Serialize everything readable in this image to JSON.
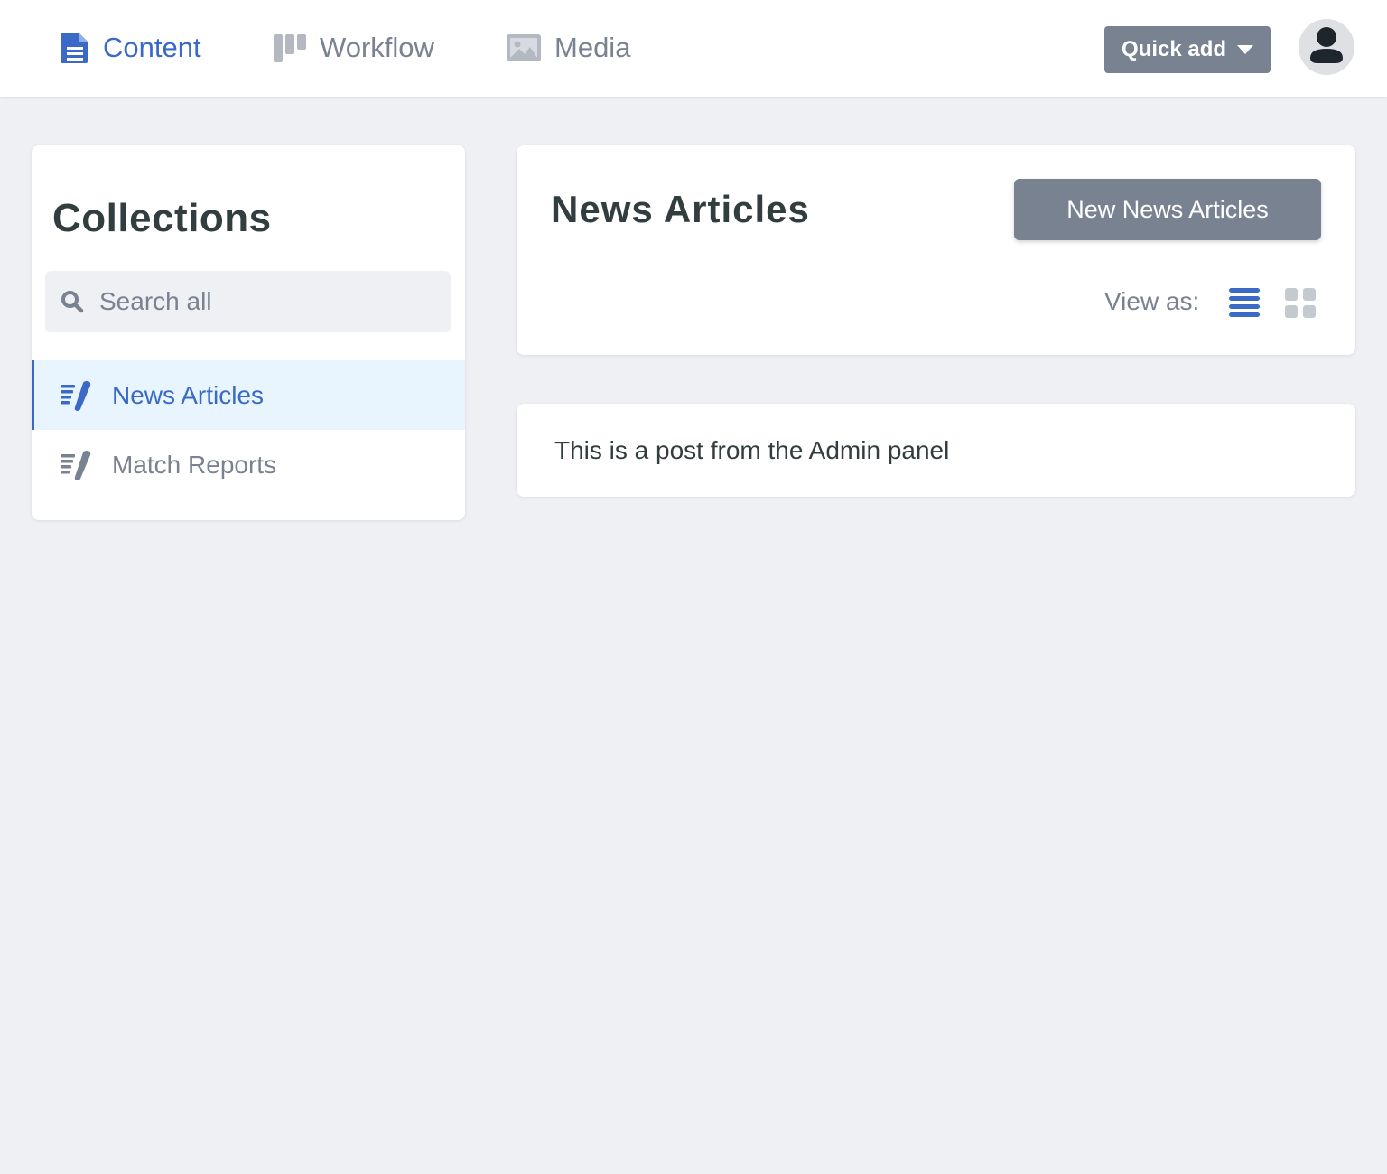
{
  "nav": {
    "items": [
      {
        "label": "Content",
        "icon": "document-icon",
        "active": true
      },
      {
        "label": "Workflow",
        "icon": "kanban-icon",
        "active": false
      },
      {
        "label": "Media",
        "icon": "image-icon",
        "active": false
      }
    ],
    "quick_add_label": "Quick add"
  },
  "sidebar": {
    "title": "Collections",
    "search_placeholder": "Search all",
    "collections": [
      {
        "label": "News Articles",
        "icon": "edit-list-icon",
        "active": true
      },
      {
        "label": "Match Reports",
        "icon": "edit-list-icon",
        "active": false
      }
    ]
  },
  "main": {
    "title": "News Articles",
    "new_button_label": "New News Articles",
    "view_as_label": "View as:",
    "view_modes": [
      "list-view-icon",
      "grid-view-icon"
    ],
    "active_view": "list-view-icon",
    "entries": [
      {
        "title": "This is a post from the Admin panel"
      }
    ]
  },
  "colors": {
    "accent": "#3a69c7",
    "muted": "#798291",
    "background": "#eff0f4",
    "active_bg": "#e8f5fe",
    "text": "#313d3e"
  }
}
